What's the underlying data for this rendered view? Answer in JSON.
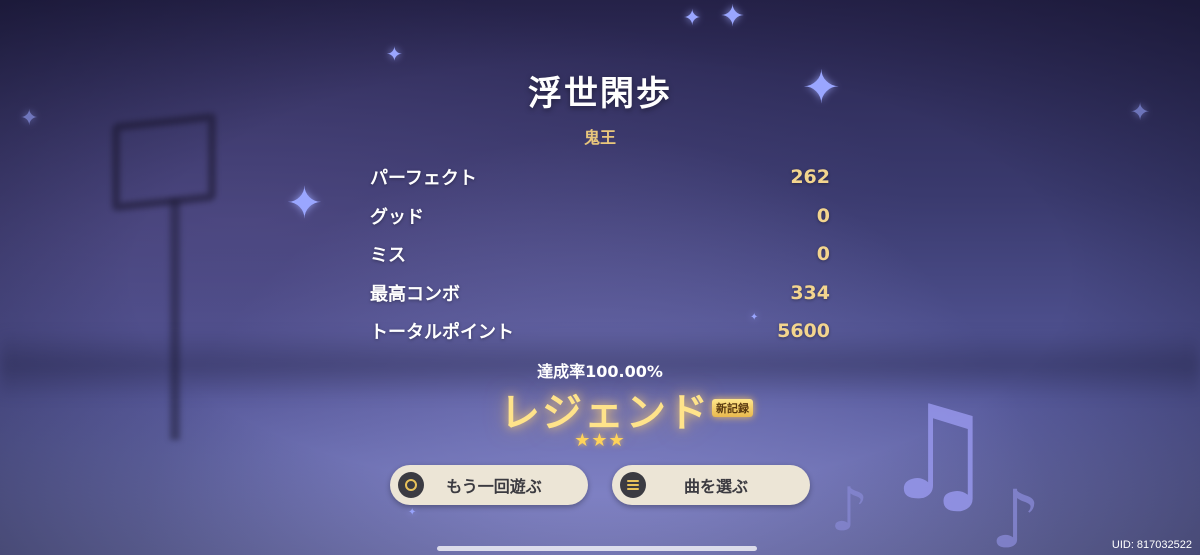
{
  "song": {
    "title": "浮世閑歩",
    "difficulty": "鬼王"
  },
  "stats": [
    {
      "label": "パーフェクト",
      "value": "262"
    },
    {
      "label": "グッド",
      "value": "0"
    },
    {
      "label": "ミス",
      "value": "0"
    },
    {
      "label": "最高コンボ",
      "value": "334"
    },
    {
      "label": "トータルポイント",
      "value": "5600"
    }
  ],
  "result": {
    "completion": "達成率100.00%",
    "rank": "レジェンド",
    "new_record_badge": "新記録",
    "stars": "★★★",
    "star_count": 3
  },
  "buttons": {
    "replay": "もう一回遊ぶ",
    "select_song": "曲を選ぶ"
  },
  "footer": {
    "uid": "UID: 817032522"
  },
  "colors": {
    "accent_gold": "#f3d58e",
    "rank_gold": "#ffe38a",
    "button_bg": "#ece5d6"
  }
}
